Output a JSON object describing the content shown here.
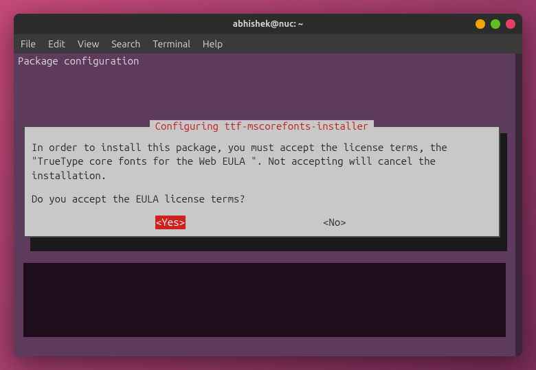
{
  "window": {
    "title": "abhishek@nuc: ~"
  },
  "menu": {
    "file": "File",
    "edit": "Edit",
    "view": "View",
    "search": "Search",
    "terminal": "Terminal",
    "help": "Help"
  },
  "terminal": {
    "header": "Package configuration"
  },
  "dialog": {
    "title": "Configuring ttf-mscorefonts-installer",
    "body_text": "In order to install this package, you must accept the license terms, the \"TrueType core fonts for the Web EULA \". Not accepting will cancel the installation.",
    "prompt": "Do you accept the EULA license terms?",
    "yes_label": "<Yes>",
    "no_label": "<No>"
  }
}
